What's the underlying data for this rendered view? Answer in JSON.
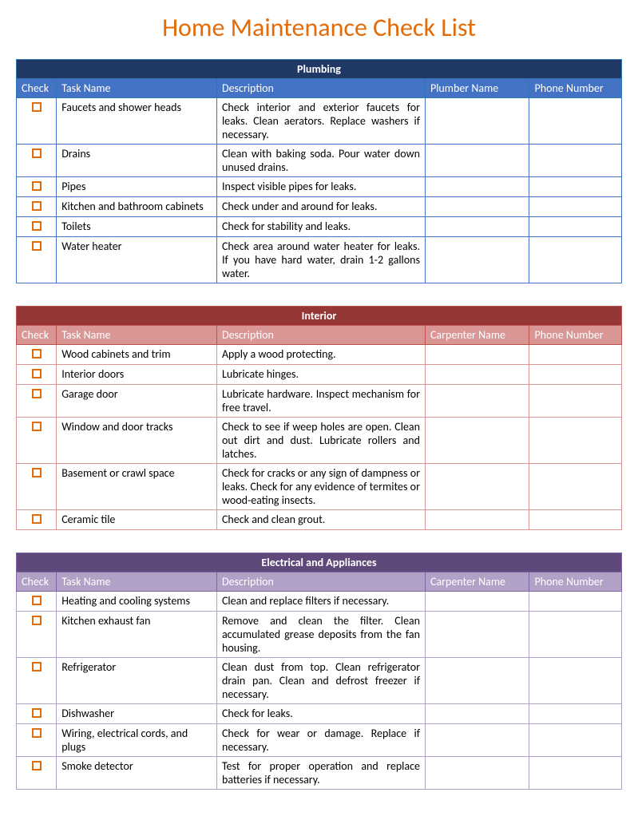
{
  "title": "Home Maintenance Check List",
  "sections": [
    {
      "theme": "plumbing",
      "name": "Plumbing",
      "headers": {
        "check": "Check",
        "task": "Task Name",
        "desc": "Description",
        "person": "Plumber Name",
        "phone": "Phone Number"
      },
      "rows": [
        {
          "task": "Faucets and shower heads",
          "desc": "Check interior and exterior faucets for leaks. Clean aerators. Replace washers if necessary."
        },
        {
          "task": "Drains",
          "desc": "Clean with baking soda. Pour water down unused drains."
        },
        {
          "task": "Pipes",
          "desc": "Inspect visible pipes for leaks."
        },
        {
          "task": "Kitchen and bathroom cabinets",
          "desc": "Check under and around for leaks."
        },
        {
          "task": "Toilets",
          "desc": "Check for stability and leaks."
        },
        {
          "task": "Water heater",
          "desc": "Check area around water heater for leaks. If you have hard water, drain 1-2 gallons water."
        }
      ]
    },
    {
      "theme": "interior",
      "name": "Interior",
      "headers": {
        "check": "Check",
        "task": "Task Name",
        "desc": "Description",
        "person": "Carpenter Name",
        "phone": "Phone Number"
      },
      "rows": [
        {
          "task": "Wood cabinets and trim",
          "desc": "Apply a wood protecting."
        },
        {
          "task": "Interior doors",
          "desc": "Lubricate hinges."
        },
        {
          "task": "Garage door",
          "desc": "Lubricate hardware. Inspect mechanism for free travel."
        },
        {
          "task": "Window and door tracks",
          "desc": "Check to see if weep holes are open. Clean out dirt and dust. Lubricate rollers and latches."
        },
        {
          "task": "Basement or crawl space",
          "desc": "Check for cracks or any sign of dampness or leaks. Check for any evidence of termites or wood-eating insects."
        },
        {
          "task": "Ceramic tile",
          "desc": "Check and clean grout."
        }
      ]
    },
    {
      "theme": "electrical",
      "name": "Electrical and Appliances",
      "headers": {
        "check": "Check",
        "task": "Task Name",
        "desc": "Description",
        "person": "Carpenter Name",
        "phone": "Phone Number"
      },
      "rows": [
        {
          "task": "Heating and cooling systems",
          "desc": "Clean and replace filters if necessary."
        },
        {
          "task": "Kitchen exhaust fan",
          "desc": "Remove and clean the filter. Clean accumulated grease deposits from the fan housing."
        },
        {
          "task": "Refrigerator",
          "desc": "Clean dust from top. Clean refrigerator drain pan. Clean and defrost freezer if necessary."
        },
        {
          "task": "Dishwasher",
          "desc": "Check for leaks."
        },
        {
          "task": "Wiring, electrical cords, and plugs",
          "desc": "Check for wear or damage. Replace if necessary."
        },
        {
          "task": "Smoke detector",
          "desc": "Test for proper operation and replace batteries if necessary."
        }
      ]
    }
  ]
}
